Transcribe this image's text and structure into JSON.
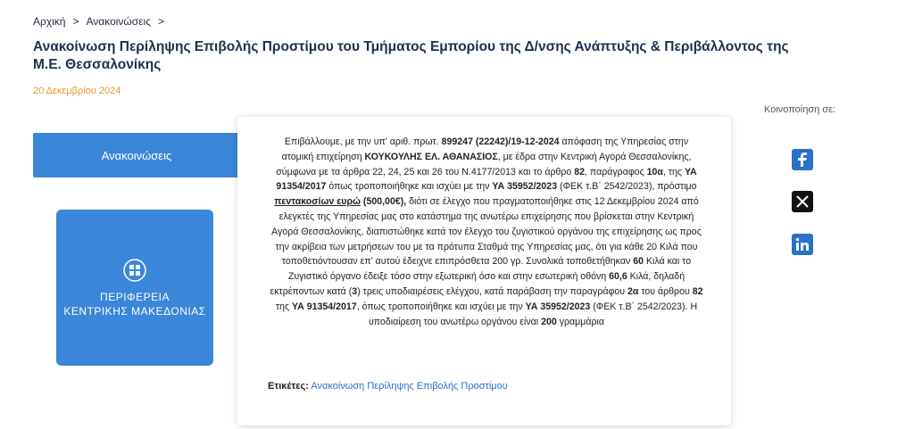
{
  "breadcrumb": {
    "home": "Αρχική",
    "sep1": ">",
    "section": "Ανακοινώσεις",
    "sep2": ">"
  },
  "title": "Ανακοίνωση Περίληψης Επιβολής Προστίμου του Τμήματος Εμπορίου της Δ/νσης Ανάπτυξης & Περιβάλλοντος της Μ.Ε. Θεσσαλονίκης",
  "date": "20 Δεκεμβρίου 2024",
  "share": {
    "label": "Κοινοποίηση σε:"
  },
  "sidebar": {
    "button_label": "Ανακοινώσεις",
    "logo_line1": "ΠΕΡΙΦΕΡΕΙΑ",
    "logo_line2": "ΚΕΝΤΡΙΚΗΣ ΜΑΚΕΔΟΝΙΑΣ"
  },
  "content": {
    "t1": "Επιβάλλουμε, με την υπ' αριθ. πρωτ. ",
    "b1": "899247 (22242)/19-12-2024",
    "t2": " απόφαση της Υπηρεσίας στην ατομική επιχείρηση ",
    "b2": "ΚΟΥΚΟΥΛΗΣ ΕΛ. ΑΘΑΝΑΣΙΟΣ",
    "t3": ", με έδρα στην Κεντρική Αγορά Θεσσαλονίκης, σύμφωνα με τα άρθρα 22, 24, 25 και 26 του Ν.4177/2013 και το άρθρο ",
    "b3": "82",
    "t4": ", παράγραφος ",
    "b4": "10α",
    "t5": ", της ",
    "b5": "ΥΑ 91354/2017",
    "t6": " όπως τροποποιήθηκε και ισχύει με την ",
    "b6": "ΥΑ 35952/2023",
    "t7": " (ΦΕΚ τ.Β΄ 2542/2023), πρόστιμο ",
    "u1": "πεντακοσίων ευρώ",
    "b7": " (500,00€),",
    "t8": " διότι σε έλεγχο που πραγματοποιήθηκε στις 12 Δεκεμβρίου 2024 από ελεγκτές της Υπηρεσίας μας στο κατάστημα της ανωτέρω επιχείρησης που βρίσκεται στην Κεντρική Αγορά Θεσσαλονίκης, διαπιστώθηκε κατά τον έλεγχο του ζυγιστικού οργάνου της επιχείρησης ως προς την ακρίβεια των μετρήσεων του με τα πρότυπα Σταθμά της Υπηρεσίας μας, ότι για κάθε 20 Κιλά που τοποθετιόντουσαν επ' αυτού έδειχνε επιπρόσθετα 200 γρ. Συνολικά τοποθετήθηκαν ",
    "b8": "60",
    "t9": " Κιλά και το Ζυγιστικό όργανο έδειξε τόσο στην εξωτερική όσο και στην εσωτερική οθόνη ",
    "b9": "60,6",
    "t10": " Κιλά, δηλαδή εκτρέποντων κατά (",
    "b10": "3",
    "t11": ") τρεις υποδιαιρέσεις ελέγχου, κατά παράβαση την παραγράφου ",
    "b11": "2α",
    "t12": " του άρθρου ",
    "b12": "82",
    "t13": " της ",
    "b13": "ΥΑ 91354/2017",
    "t14": ", όπως τροποποιήθηκε και ισχύει με την ",
    "b14": "ΥΑ 35952/2023",
    "t15": " (ΦΕΚ τ.Β΄ 2542/2023). Η υποδιαίρεση του ανωτέρω οργάνου είναι ",
    "b15": "200",
    "t16": " γραμμάρια"
  },
  "tags": {
    "label": "Ετικέτες:",
    "value": "Ανακοίνωση Περίληψης Επιβολής Προστίμου"
  },
  "icons": {
    "facebook": "facebook-icon",
    "x": "x-icon",
    "linkedin": "linkedin-icon",
    "emblem": "emblem-icon"
  },
  "colors": {
    "accent": "#3a86d8",
    "date": "#e8952f",
    "link": "#2a6fc9",
    "title": "#1c3050"
  }
}
